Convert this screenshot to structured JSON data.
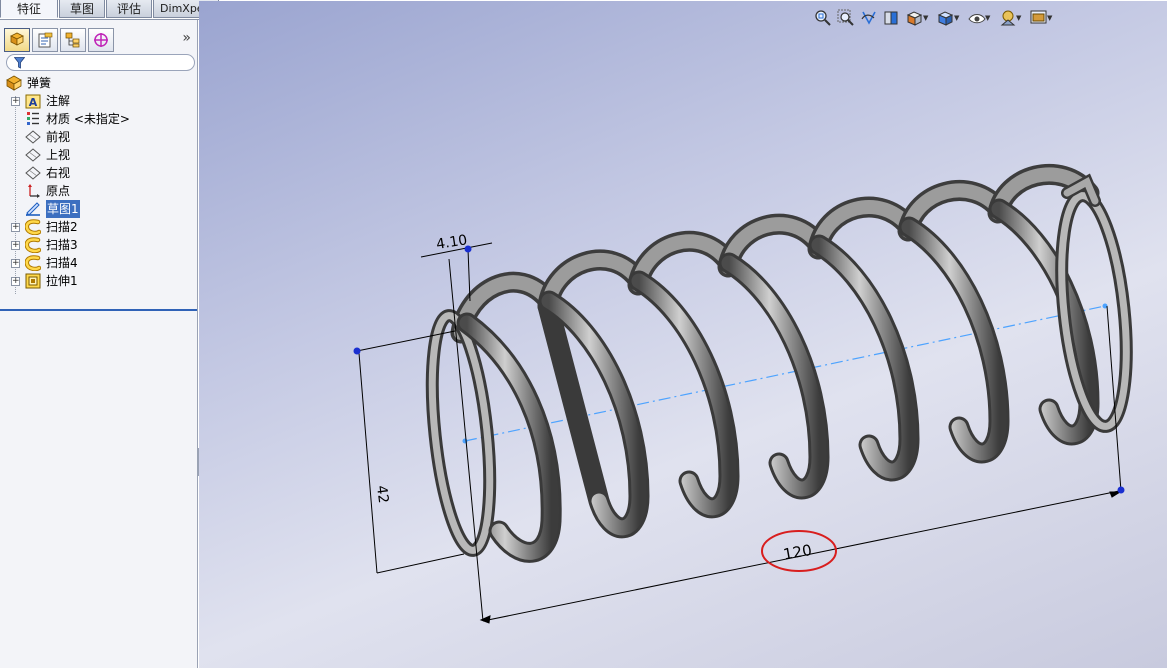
{
  "tabs": [
    "特征",
    "草图",
    "评估",
    "DimXpert"
  ],
  "active_tab": "特征",
  "pane": {
    "tabs": [
      "featuremanager-icon",
      "propertymanager-icon",
      "configurationmanager-icon",
      "dimxpert-manager-icon"
    ],
    "expand_glyph": "»",
    "filter_icon": "filter-icon"
  },
  "tree": {
    "root": "弹簧",
    "items": [
      {
        "label": "注解",
        "icon": "annotations-icon",
        "expandable": true
      },
      {
        "label": "材质 <未指定>",
        "icon": "material-icon",
        "expandable": false
      },
      {
        "label": "前视",
        "icon": "plane-icon",
        "expandable": false
      },
      {
        "label": "上视",
        "icon": "plane-icon",
        "expandable": false
      },
      {
        "label": "右视",
        "icon": "plane-icon",
        "expandable": false
      },
      {
        "label": "原点",
        "icon": "origin-icon",
        "expandable": false
      },
      {
        "label": "草图1",
        "icon": "sketch-icon",
        "expandable": false,
        "selected": true
      },
      {
        "label": "扫描2",
        "icon": "sweep-icon",
        "expandable": true
      },
      {
        "label": "扫描3",
        "icon": "sweep-icon",
        "expandable": true
      },
      {
        "label": "扫描4",
        "icon": "sweep-icon",
        "expandable": true
      },
      {
        "label": "拉伸1",
        "icon": "extrude-icon",
        "expandable": true
      }
    ]
  },
  "headsup_toolbar": [
    "zoom-to-fit-icon",
    "zoom-to-area-icon",
    "previous-view-icon",
    "section-view-icon",
    "view-orientation-icon",
    "display-style-icon",
    "hide-show-items-icon",
    "edit-appearance-icon",
    "apply-scene-icon"
  ],
  "dimensions": {
    "pitch": "4.10",
    "diameter": "42",
    "length": "120"
  },
  "colors": {
    "selection": "#3c6fc0",
    "sketch_line": "#4da3ff",
    "highlight_circle": "#d81e1e",
    "spring": "#7c7c7c"
  }
}
